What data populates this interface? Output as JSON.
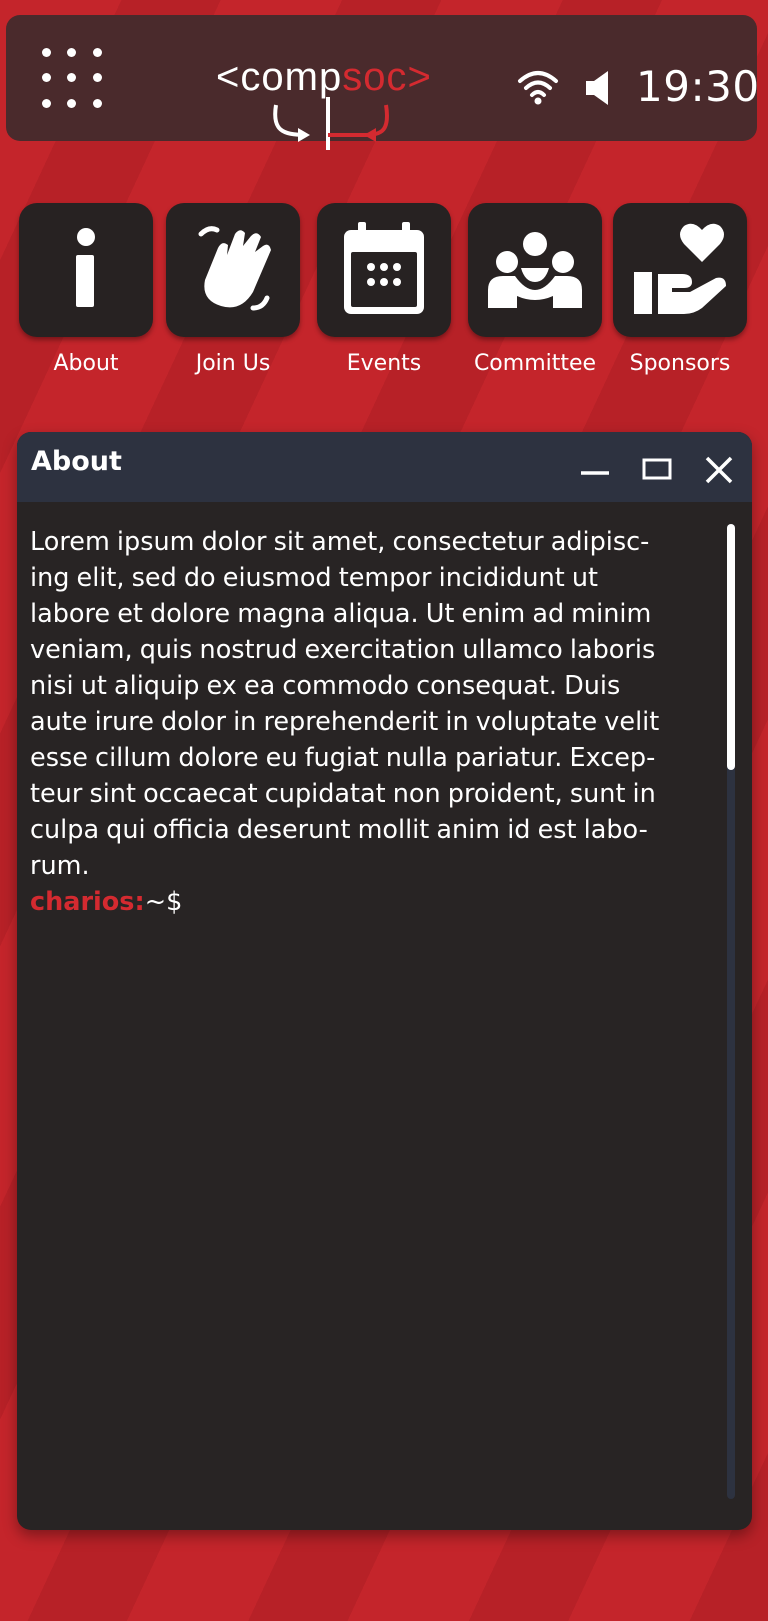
{
  "topbar": {
    "clock": "19:30",
    "icons": [
      "app-grid-icon",
      "compsoc-logo",
      "wifi-icon",
      "speaker-icon"
    ],
    "logo_text": {
      "open": "<co",
      "m": "m",
      "p": "p",
      "soc": "soc",
      "close": ">"
    }
  },
  "launcher": {
    "items": [
      {
        "label": "About",
        "icon": "info-icon"
      },
      {
        "label": "Join Us",
        "icon": "waving-hand-icon"
      },
      {
        "label": "Events",
        "icon": "calendar-icon"
      },
      {
        "label": "Committee",
        "icon": "people-icon"
      },
      {
        "label": "Sponsors",
        "icon": "hand-heart-icon"
      }
    ]
  },
  "window": {
    "title": "About",
    "body_lines": [
      "Lorem ipsum dolor sit amet, consectetur adipisc-",
      "ing elit, sed do eiusmod tempor incididunt ut",
      "labore et dolore magna aliqua. Ut enim ad minim",
      "veniam, quis nostrud exercitation ullamco laboris",
      "nisi ut aliquip ex ea commodo consequat. Duis",
      "aute irure dolor in reprehenderit in voluptate velit",
      "esse cillum dolore eu fugiat nulla pariatur. Excep-",
      "teur sint occaecat cupidatat non proident, sunt in",
      "culpa qui officia deserunt mollit anim id est labo-",
      "rum."
    ],
    "prompt_user": "charios:",
    "prompt_path": "~$"
  },
  "colors": {
    "accent": "#d42a30",
    "background": "#c4252b",
    "titlebar": "#2d3240",
    "window": "#282424",
    "tile": "#272222"
  }
}
